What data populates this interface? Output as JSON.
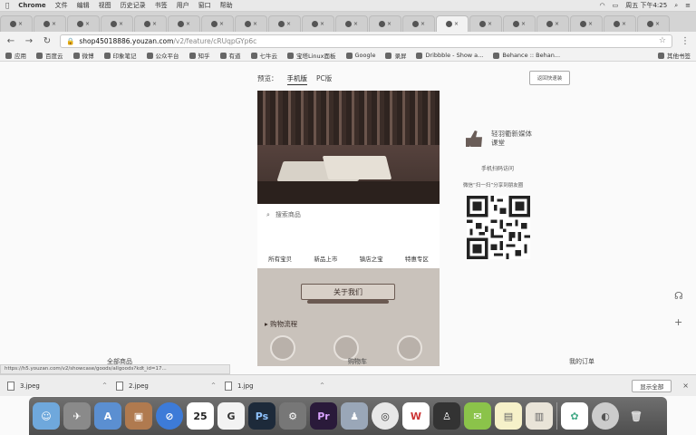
{
  "menubar": {
    "app": "Chrome",
    "items": [
      "文件",
      "编辑",
      "视图",
      "历史记录",
      "书签",
      "用户",
      "窗口",
      "帮助"
    ],
    "clock": "周五 下午4:25"
  },
  "toolbar": {
    "url_host": "shop45018886.youzan.com",
    "url_path": "/v2/feature/cRUqpGYp6c"
  },
  "bookmarks": {
    "items": [
      "应用",
      "百度云",
      "微博",
      "印象笔记",
      "公众平台",
      "知乎",
      "有道",
      "七牛云",
      "宝塔Linux面板",
      "Google",
      "录屏",
      "Dribbble - Show a...",
      "Behance :: Behan..."
    ],
    "other": "其他书签"
  },
  "page": {
    "preview_label": "预览：",
    "mobile_tab": "手机版",
    "pc_tab": "PC版",
    "return_button": "返回快速装",
    "search_placeholder": "搜索商品",
    "nav": [
      "所有宝贝",
      "新品上市",
      "镇店之宝",
      "特惠专区"
    ],
    "about_button": "关于我们",
    "process_label": "购物流程",
    "like_text": "轻羽衢新媒体课堂",
    "mobile_visit": "手机扫码访问",
    "scan_text": "微信“扫一扫”分享到朋友圈",
    "bottom_tabs": [
      "全部商品",
      "购物车",
      "我的订单"
    ]
  },
  "status_url": "https://h5.youzan.com/v2/showcase/goods/allgoods?kdt_id=17...",
  "downloads": {
    "files": [
      "3.jpeg",
      "2.jpeg",
      "1.jpg"
    ],
    "show_all": "显示全部"
  },
  "dock": {
    "icons": [
      "finder-icon",
      "launchpad-icon",
      "appstore-icon",
      "preview-icon",
      "safari-icon",
      "calendar-icon",
      "google-icon",
      "photoshop-icon",
      "settings-icon",
      "premiere-icon",
      "keynote-icon",
      "chrome-icon",
      "wps-icon",
      "qq-icon",
      "wechat-icon",
      "notes-icon",
      "bookshelf-icon",
      "mindmap-icon",
      "evernote-icon",
      "trash-icon"
    ],
    "calendar_day": "25",
    "ps_label": "Ps",
    "pr_label": "Pr"
  }
}
